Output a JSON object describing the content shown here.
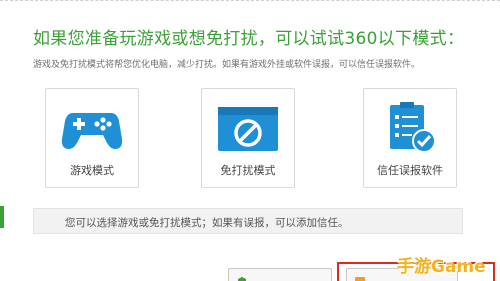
{
  "header": {
    "title": "如果您准备玩游戏或想免打扰，可以试试360以下模式：",
    "subtitle": "游戏及免打扰模式将帮您优化电脑，减少打扰。如果有游戏外挂或软件误报，可以信任误报软件。"
  },
  "modes": [
    {
      "label": "游戏模式",
      "icon": "gamepad-icon"
    },
    {
      "label": "免打扰模式",
      "icon": "no-disturb-icon"
    },
    {
      "label": "信任误报软件",
      "icon": "trusted-checklist-icon"
    }
  ],
  "info": {
    "text": "您可以选择游戏或免打扰模式；如果有误报，可以添加信任。"
  },
  "colors": {
    "accent_green": "#3aa136",
    "icon_blue": "#1f8fd6",
    "highlight_red": "#e02a1e",
    "watermark_orange": "#f6b21b"
  },
  "watermark": {
    "text": "手游Game"
  }
}
